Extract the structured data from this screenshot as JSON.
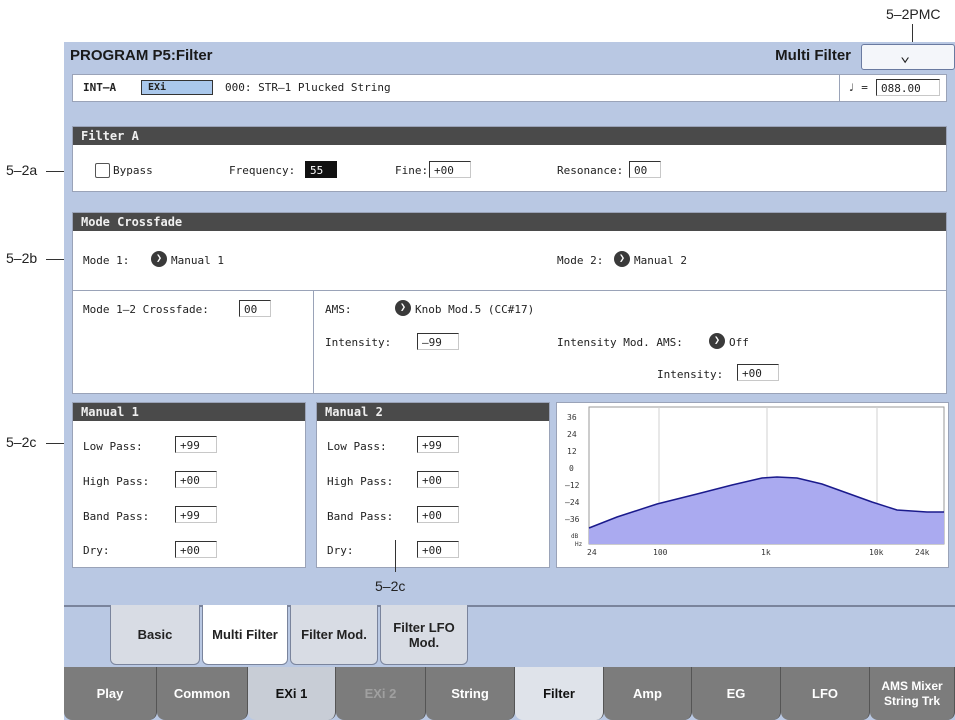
{
  "callouts": {
    "pmc": "5–2PMC",
    "a": "5–2a",
    "b": "5–2b",
    "c": "5–2c",
    "c_bottom": "5–2c"
  },
  "header": {
    "title": "PROGRAM P5:Filter",
    "page_menu_label": "Multi Filter",
    "page_menu_icon": "chevron-down-icon"
  },
  "program": {
    "bank": "INT–A",
    "engine_badge": "EXi",
    "name": "000: STR–1 Plucked String",
    "tempo_symbol": "♩ =",
    "tempo": "088.00"
  },
  "filter_a": {
    "header": "Filter A",
    "bypass_label": "Bypass",
    "bypass_checked": false,
    "frequency_label": "Frequency:",
    "frequency": "55",
    "fine_label": "Fine:",
    "fine": "+00",
    "resonance_label": "Resonance:",
    "resonance": "00"
  },
  "mode_crossfade": {
    "header": "Mode Crossfade",
    "mode1_label": "Mode 1:",
    "mode1": "Manual 1",
    "mode2_label": "Mode 2:",
    "mode2": "Manual 2",
    "crossfade_label": "Mode 1–2 Crossfade:",
    "crossfade": "00",
    "ams_label": "AMS:",
    "ams": "Knob Mod.5 (CC#17)",
    "intensity_label": "Intensity:",
    "intensity": "–99",
    "intensity_mod_ams_label": "Intensity Mod. AMS:",
    "intensity_mod_ams": "Off",
    "intensity2_label": "Intensity:",
    "intensity2": "+00"
  },
  "manual1": {
    "header": "Manual 1",
    "low_pass_label": "Low Pass:",
    "low_pass": "+99",
    "high_pass_label": "High Pass:",
    "high_pass": "+00",
    "band_pass_label": "Band Pass:",
    "band_pass": "+99",
    "dry_label": "Dry:",
    "dry": "+00"
  },
  "manual2": {
    "header": "Manual 2",
    "low_pass_label": "Low Pass:",
    "low_pass": "+99",
    "high_pass_label": "High Pass:",
    "high_pass": "+00",
    "band_pass_label": "Band Pass:",
    "band_pass": "+00",
    "dry_label": "Dry:",
    "dry": "+00"
  },
  "graph": {
    "y_ticks": [
      "36",
      "24",
      "12",
      "0",
      "–12",
      "–24",
      "–36"
    ],
    "x_ticks": [
      "24",
      "100",
      "1k",
      "10k",
      "24k"
    ],
    "unit_top": "dB",
    "unit_bottom": "Hz",
    "fill_color": "#aaaaf0",
    "line_color": "#1a1a8c"
  },
  "sub_tabs": [
    {
      "label": "Basic"
    },
    {
      "label": "Multi Filter",
      "active": true
    },
    {
      "label": "Filter Mod."
    },
    {
      "label": "Filter LFO Mod."
    }
  ],
  "main_tabs": [
    {
      "label": "Play"
    },
    {
      "label": "Common"
    },
    {
      "label": "EXi 1",
      "light": true
    },
    {
      "label": "EXi 2",
      "dim": true
    },
    {
      "label": "String"
    },
    {
      "label": "Filter",
      "active": true
    },
    {
      "label": "Amp"
    },
    {
      "label": "EG"
    },
    {
      "label": "LFO"
    },
    {
      "label": "AMS Mixer String Trk"
    }
  ]
}
